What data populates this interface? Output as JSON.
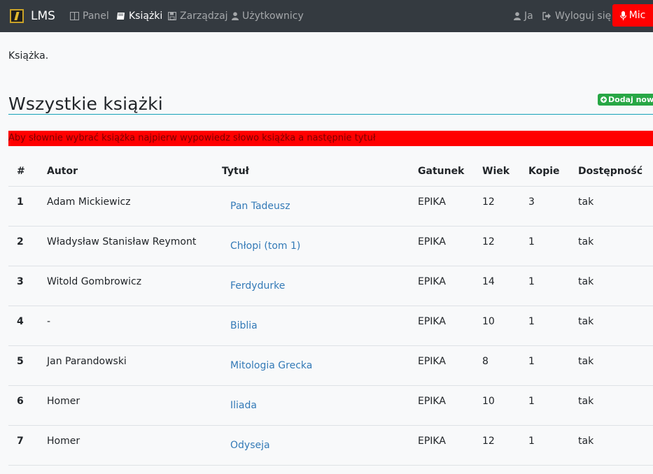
{
  "navbar": {
    "brand": "LMS",
    "links": [
      {
        "label": "Panel",
        "icon": "columns-icon"
      },
      {
        "label": "Książki",
        "icon": "book-icon",
        "active": true
      },
      {
        "label": "Zarządzaj",
        "icon": "save-icon"
      },
      {
        "label": "Użytkownicy",
        "icon": "user-icon"
      }
    ],
    "right_links": [
      {
        "label": "Ja",
        "icon": "user-icon"
      },
      {
        "label": "Wyloguj się",
        "icon": "sign-out-icon"
      }
    ],
    "mic_label": "Mic",
    "mic_color": "#ff0000"
  },
  "page": {
    "subtitle": "Książka.",
    "heading": "Wszystkie książki",
    "add_button": "Dodaj nową",
    "alert": "Aby słownie wybrać książka najpierw wypowiedz słowo książka a następnie tytuł"
  },
  "table": {
    "headers": [
      "#",
      "Autor",
      "Tytuł",
      "Gatunek",
      "Wiek",
      "Kopie",
      "Dostępność"
    ],
    "rows": [
      {
        "num": "1",
        "autor": "Adam Mickiewicz",
        "tytul": "Pan Tadeusz",
        "gatunek": "EPIKA",
        "wiek": "12",
        "kopie": "3",
        "dostepnosc": "tak"
      },
      {
        "num": "2",
        "autor": "Władysław Stanisław Reymont",
        "tytul": "Chłopi (tom 1)",
        "gatunek": "EPIKA",
        "wiek": "12",
        "kopie": "1",
        "dostepnosc": "tak"
      },
      {
        "num": "3",
        "autor": "Witold Gombrowicz",
        "tytul": "Ferdydurke",
        "gatunek": "EPIKA",
        "wiek": "14",
        "kopie": "1",
        "dostepnosc": "tak"
      },
      {
        "num": "4",
        "autor": "-",
        "tytul": "Biblia",
        "gatunek": "EPIKA",
        "wiek": "10",
        "kopie": "1",
        "dostepnosc": "tak"
      },
      {
        "num": "5",
        "autor": "Jan Parandowski",
        "tytul": "Mitologia Grecka",
        "gatunek": "EPIKA",
        "wiek": "8",
        "kopie": "1",
        "dostepnosc": "tak"
      },
      {
        "num": "6",
        "autor": "Homer",
        "tytul": "Iliada",
        "gatunek": "EPIKA",
        "wiek": "10",
        "kopie": "1",
        "dostepnosc": "tak"
      },
      {
        "num": "7",
        "autor": "Homer",
        "tytul": "Odyseja",
        "gatunek": "EPIKA",
        "wiek": "12",
        "kopie": "1",
        "dostepnosc": "tak"
      }
    ]
  }
}
